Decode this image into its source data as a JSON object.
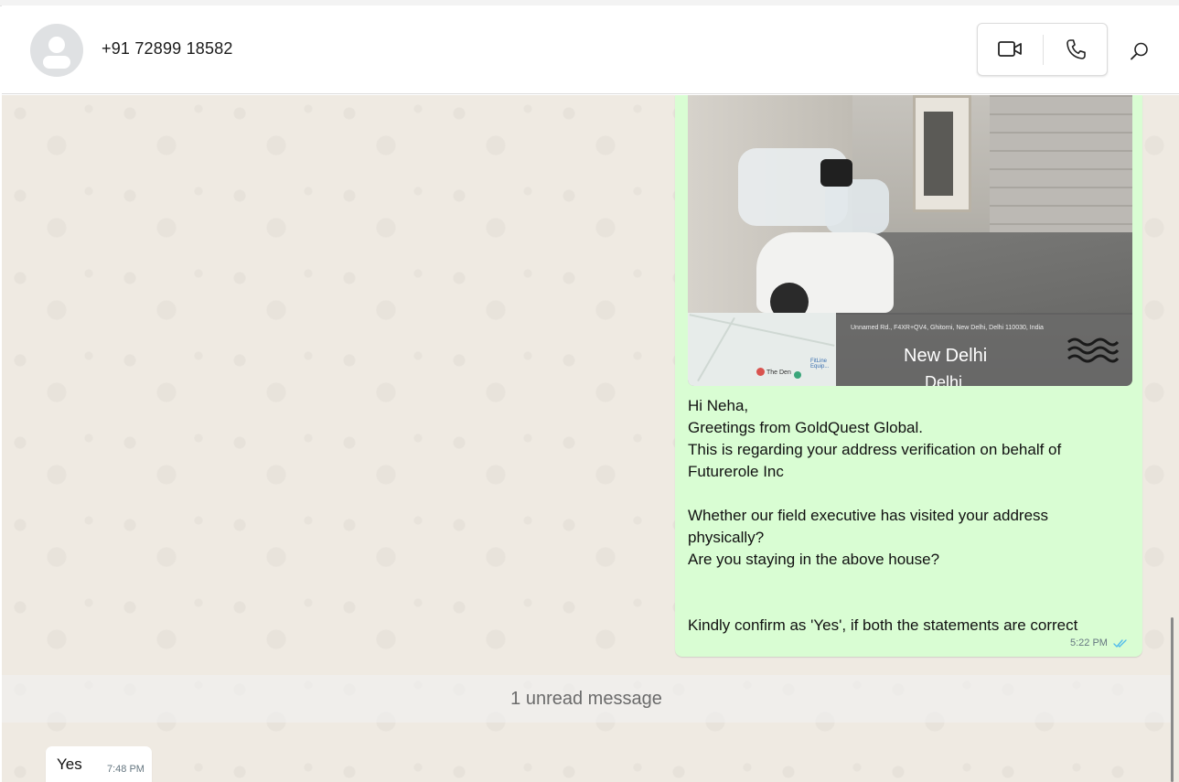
{
  "header": {
    "contact_name": "+91 72899 18582"
  },
  "icons": {
    "avatar": "default-person-icon",
    "video_call": "video-camera-icon",
    "voice_call": "phone-icon",
    "search": "search-icon",
    "read_receipt": "double-check-icon"
  },
  "outgoing_message": {
    "attachment": {
      "type": "geotagged-photo",
      "address": "Unnamed Rd., F4XR+QV4, Ghitorni, New Delhi, Delhi 110030, India",
      "city": "New Delhi",
      "state": "Delhi",
      "map_labels": [
        "The Den",
        "FitLine Equip..."
      ]
    },
    "lines": [
      "Hi Neha,",
      "Greetings from GoldQuest Global.",
      "This is regarding your address verification on behalf of",
      "Futurerole Inc",
      "",
      "Whether our field executive has visited your address",
      "physically?",
      "Are you staying in the above house?",
      "",
      "",
      "Kindly confirm as 'Yes', if both the statements are correct"
    ],
    "time": "5:22 PM",
    "status": "read"
  },
  "unread_divider": {
    "label": "1 unread message"
  },
  "incoming_message": {
    "text": "Yes",
    "time": "7:48 PM"
  },
  "colors": {
    "outgoing_bubble": "#d9fdd3",
    "incoming_bubble": "#ffffff",
    "chat_background": "#efeae2",
    "read_tick": "#53bdeb"
  }
}
